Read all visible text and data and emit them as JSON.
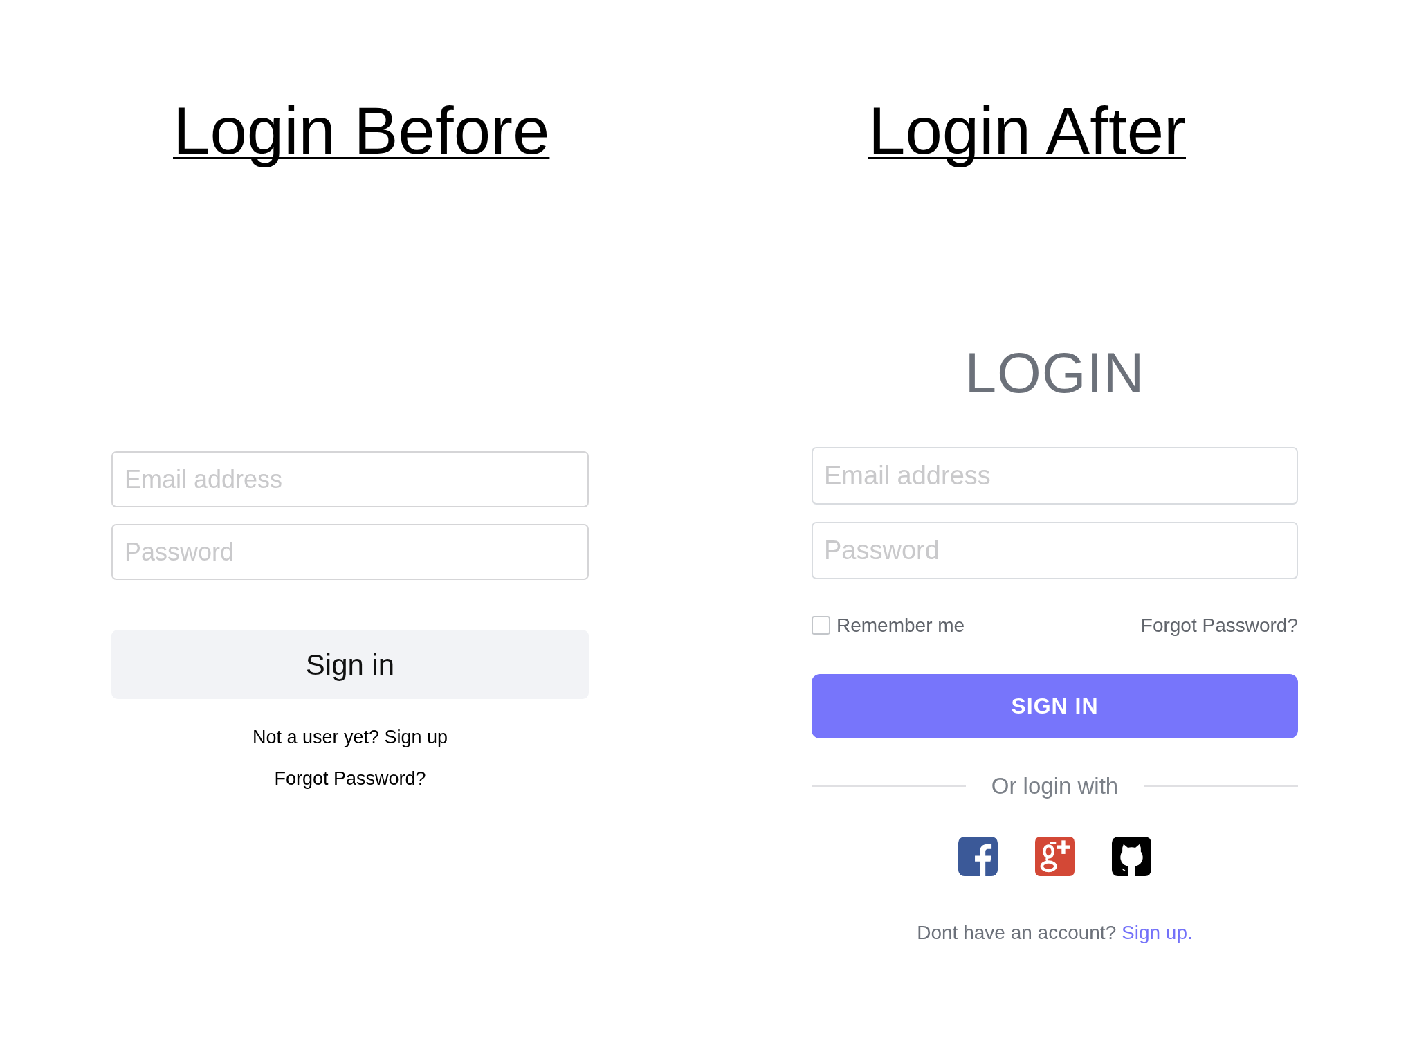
{
  "panels": [
    {
      "kind": "before",
      "title": "Login Before",
      "fields": [
        {
          "placeholder": "Email address"
        },
        {
          "placeholder": "Password"
        }
      ],
      "submit": "Sign in",
      "links": [
        "Not a user yet? Sign up",
        "Forgot Password?"
      ]
    },
    {
      "kind": "after",
      "title": "Login After",
      "heading": "LOGIN",
      "fields": [
        {
          "placeholder": "Email address"
        },
        {
          "placeholder": "Password"
        }
      ],
      "remember": {
        "label": "Remember me",
        "checked": false
      },
      "forgot": "Forgot Password?",
      "submit": "SIGN IN",
      "divider": "Or login with",
      "social": [
        {
          "kind": "facebook"
        },
        {
          "kind": "google-plus"
        },
        {
          "kind": "github"
        }
      ],
      "signup": {
        "text": "Dont have an account?",
        "link": "Sign up."
      }
    }
  ]
}
